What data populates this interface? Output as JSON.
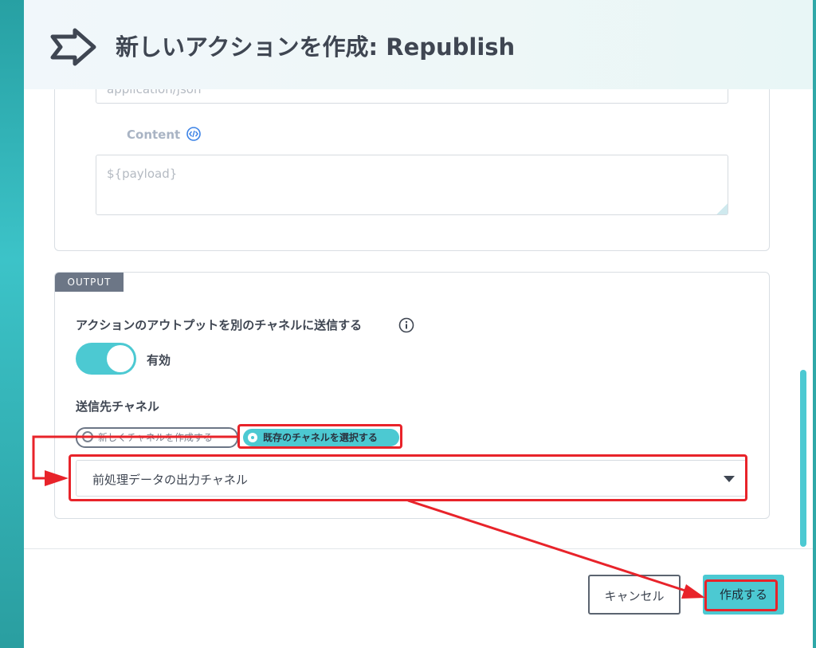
{
  "modal": {
    "title": "新しいアクションを作成: Republish"
  },
  "form": {
    "content_type_placeholder": "application/json",
    "content_label": "Content",
    "content_placeholder": "${payload}"
  },
  "output": {
    "section_tag": "OUTPUT",
    "send_output_label": "アクションのアウトプットを別のチャネルに送信する",
    "toggle_state_label": "有効",
    "toggle_on": true,
    "destination_label": "送信先チャネル",
    "radio_new_label": "新しくチャネルを作成する",
    "radio_existing_label": "既存のチャネルを選択する",
    "selected_radio": "既存のチャネルを選択する",
    "channel_select_value": "前処理データの出力チャネル"
  },
  "footer": {
    "cancel_label": "キャンセル",
    "create_label": "作成する"
  },
  "icons": {
    "header": "send-arrow-icon",
    "content_help": "code-icon",
    "info": "info-icon",
    "select": "caret-down-icon"
  },
  "colors": {
    "accent": "#4cc9d2",
    "annotation": "#e8232a",
    "text": "#3f4652",
    "tag_bg": "#6c7686"
  }
}
